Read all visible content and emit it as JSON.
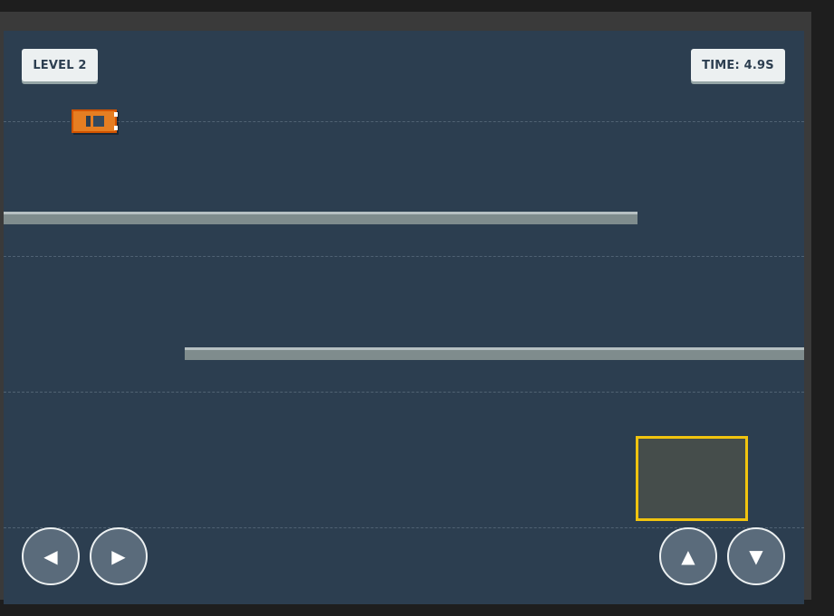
{
  "hud": {
    "level_label": "LEVEL 2",
    "time_label": "TIME: 4.9S"
  },
  "controls": {
    "left_glyph": "◀",
    "right_glyph": "▶",
    "up_glyph": "▲",
    "down_glyph": "▼"
  },
  "colors": {
    "road": "#2c3e50",
    "car": "#e67e22",
    "barrier": "#7f8c8d",
    "parking_outline": "#f1c40f",
    "hud_pill": "#ecf0f1"
  },
  "icons": [
    "car-icon",
    "arrow-left-icon",
    "arrow-right-icon",
    "arrow-up-icon",
    "arrow-down-icon"
  ]
}
